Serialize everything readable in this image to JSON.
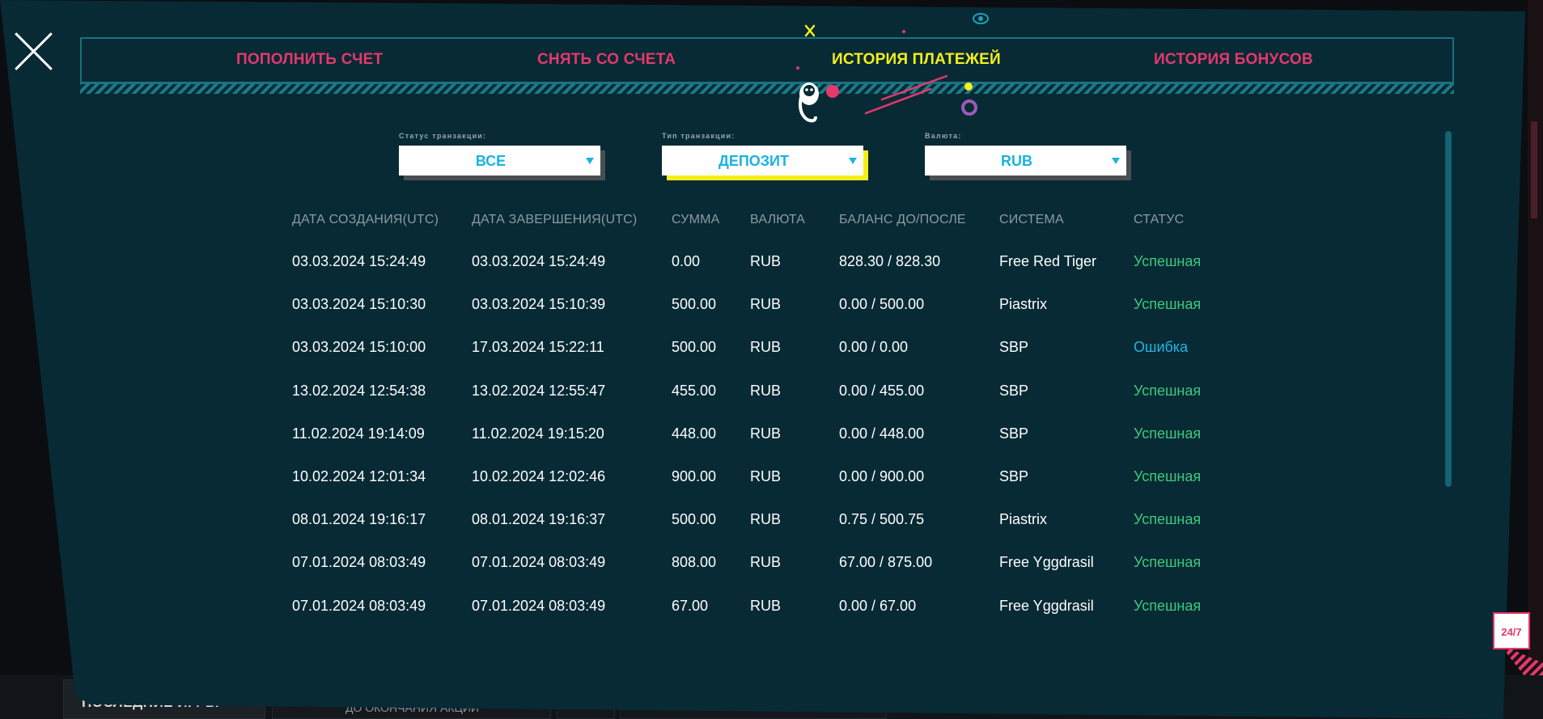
{
  "background": {
    "last_games_label": "ПОСЛЕДНИЕ ИГРЫ",
    "promo_text": "ДО ОКОНЧАНИЯ АКЦИИ"
  },
  "tabs": [
    {
      "label": "ПОПОЛНИТЬ СЧЕТ",
      "active": false
    },
    {
      "label": "СНЯТЬ СО СЧЕТА",
      "active": false
    },
    {
      "label": "ИСТОРИЯ ПЛАТЕЖЕЙ",
      "active": true
    },
    {
      "label": "ИСТОРИЯ БОНУСОВ",
      "active": false
    }
  ],
  "filters": {
    "status": {
      "label": "Статус транзакции:",
      "value": "ВСЕ"
    },
    "type": {
      "label": "Тип транзакции:",
      "value": "ДЕПОЗИТ"
    },
    "currency": {
      "label": "Валюта:",
      "value": "RUB"
    }
  },
  "table": {
    "headers": [
      "ДАТА СОЗДАНИЯ(UTC)",
      "ДАТА ЗАВЕРШЕНИЯ(UTC)",
      "СУММА",
      "ВАЛЮТА",
      "БАЛАНС ДО/ПОСЛЕ",
      "СИСТЕМА",
      "СТАТУС"
    ],
    "rows": [
      [
        "03.03.2024 15:24:49",
        "03.03.2024 15:24:49",
        "0.00",
        "RUB",
        "828.30 / 828.30",
        "Free Red Tiger",
        "Успешная"
      ],
      [
        "03.03.2024 15:10:30",
        "03.03.2024 15:10:39",
        "500.00",
        "RUB",
        "0.00 / 500.00",
        "Piastrix",
        "Успешная"
      ],
      [
        "03.03.2024 15:10:00",
        "17.03.2024 15:22:11",
        "500.00",
        "RUB",
        "0.00 / 0.00",
        "SBP",
        "Ошибка"
      ],
      [
        "13.02.2024 12:54:38",
        "13.02.2024 12:55:47",
        "455.00",
        "RUB",
        "0.00 / 455.00",
        "SBP",
        "Успешная"
      ],
      [
        "11.02.2024 19:14:09",
        "11.02.2024 19:15:20",
        "448.00",
        "RUB",
        "0.00 / 448.00",
        "SBP",
        "Успешная"
      ],
      [
        "10.02.2024 12:01:34",
        "10.02.2024 12:02:46",
        "900.00",
        "RUB",
        "0.00 / 900.00",
        "SBP",
        "Успешная"
      ],
      [
        "08.01.2024 19:16:17",
        "08.01.2024 19:16:37",
        "500.00",
        "RUB",
        "0.75 / 500.75",
        "Piastrix",
        "Успешная"
      ],
      [
        "07.01.2024 08:03:49",
        "07.01.2024 08:03:49",
        "808.00",
        "RUB",
        "67.00 / 875.00",
        "Free Yggdrasil",
        "Успешная"
      ],
      [
        "07.01.2024 08:03:49",
        "07.01.2024 08:03:49",
        "67.00",
        "RUB",
        "0.00 / 67.00",
        "Free Yggdrasil",
        "Успешная"
      ]
    ]
  },
  "support": {
    "label": "24/7"
  },
  "colors": {
    "modal_bg": "#072a35",
    "tab_pink": "#e5386c",
    "tab_active": "#f5ef1b",
    "status_ok": "#3ec97b",
    "status_error": "#1fb4e6",
    "select_text": "#19b3df"
  }
}
